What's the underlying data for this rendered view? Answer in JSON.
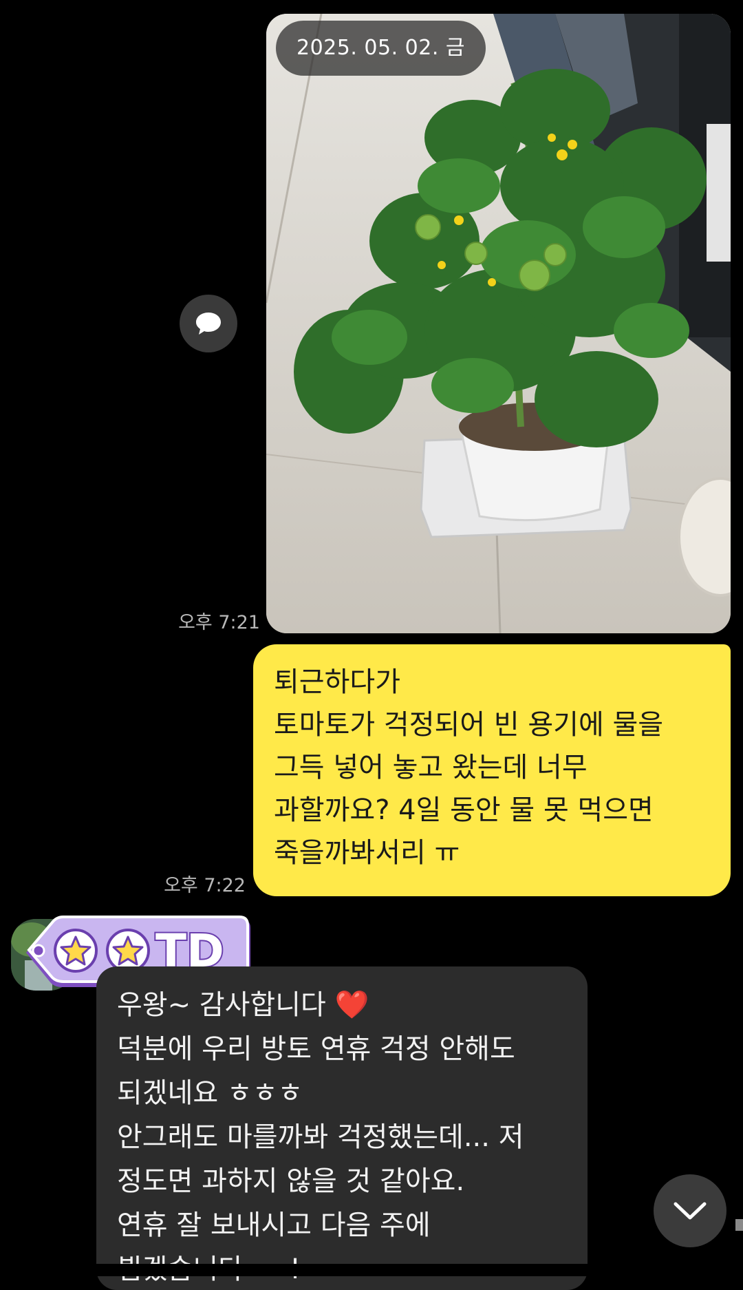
{
  "photo_message": {
    "date_label": "2025. 05. 02. 금",
    "time": "오후 7:21"
  },
  "outgoing_message": {
    "lines": [
      "퇴근하다가",
      "토마토가 걱정되어 빈 용기에 물을",
      "그득 넣어 놓고 왔는데 너무",
      "과할까요? 4일 동안 물 못 먹으면",
      "죽을까봐서리 ㅠ"
    ],
    "time": "오후 7:22"
  },
  "incoming_message": {
    "name_tag": "TD",
    "first_line": "우왕~ 감사합니다",
    "heart": "❤️",
    "lines": [
      "덕분에 우리 방토 연휴 걱정 안해도",
      "되겠네요 ㅎㅎㅎ",
      "안그래도 마를까봐 걱정했는데... 저",
      "정도면 과하지 않을 것 같아요.",
      "연휴 잘 보내시고 다음 주에",
      "뵙겠습니다~~!"
    ]
  },
  "icons": {
    "share": "speech-bubble-icon",
    "scroll": "chevron-down-icon",
    "tag_stars": "star-icon"
  },
  "colors": {
    "background": "#000000",
    "outgoing_bubble": "#ffe949",
    "incoming_bubble": "#2c2c2c",
    "tag_fill": "#c9b6f0",
    "heart": "#ff3d63"
  }
}
